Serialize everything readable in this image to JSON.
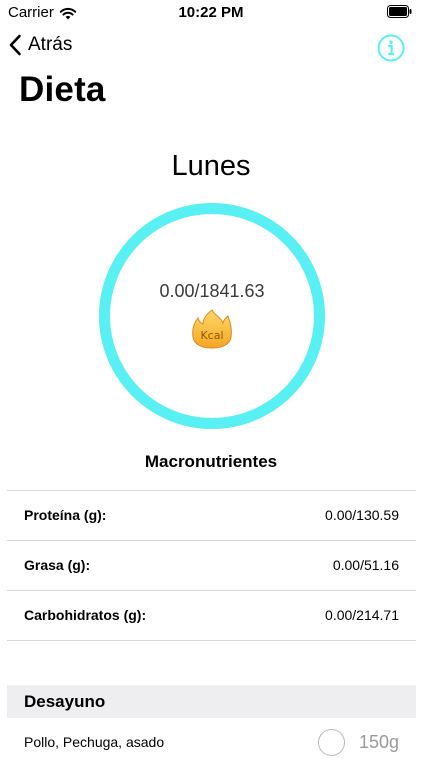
{
  "status_bar": {
    "carrier": "Carrier",
    "time": "10:22 PM"
  },
  "nav": {
    "back_label": "Atrás",
    "info_icon": "info-circle-icon"
  },
  "page": {
    "title": "Dieta"
  },
  "day": {
    "label": "Lunes"
  },
  "calories": {
    "value_text": "0.00/1841.63",
    "icon_text": "Kcal",
    "ring_color": "#59f0f4"
  },
  "macros": {
    "heading": "Macronutrientes",
    "rows": [
      {
        "label": "Proteína (g):",
        "value": "0.00/130.59"
      },
      {
        "label": "Grasa (g):",
        "value": "0.00/51.16"
      },
      {
        "label": "Carbohidratos (g):",
        "value": "0.00/214.71"
      }
    ]
  },
  "meals": [
    {
      "title": "Desayuno",
      "items": [
        {
          "name": "Pollo, Pechuga, asado",
          "quantity": "150g",
          "checked": false
        }
      ]
    }
  ]
}
